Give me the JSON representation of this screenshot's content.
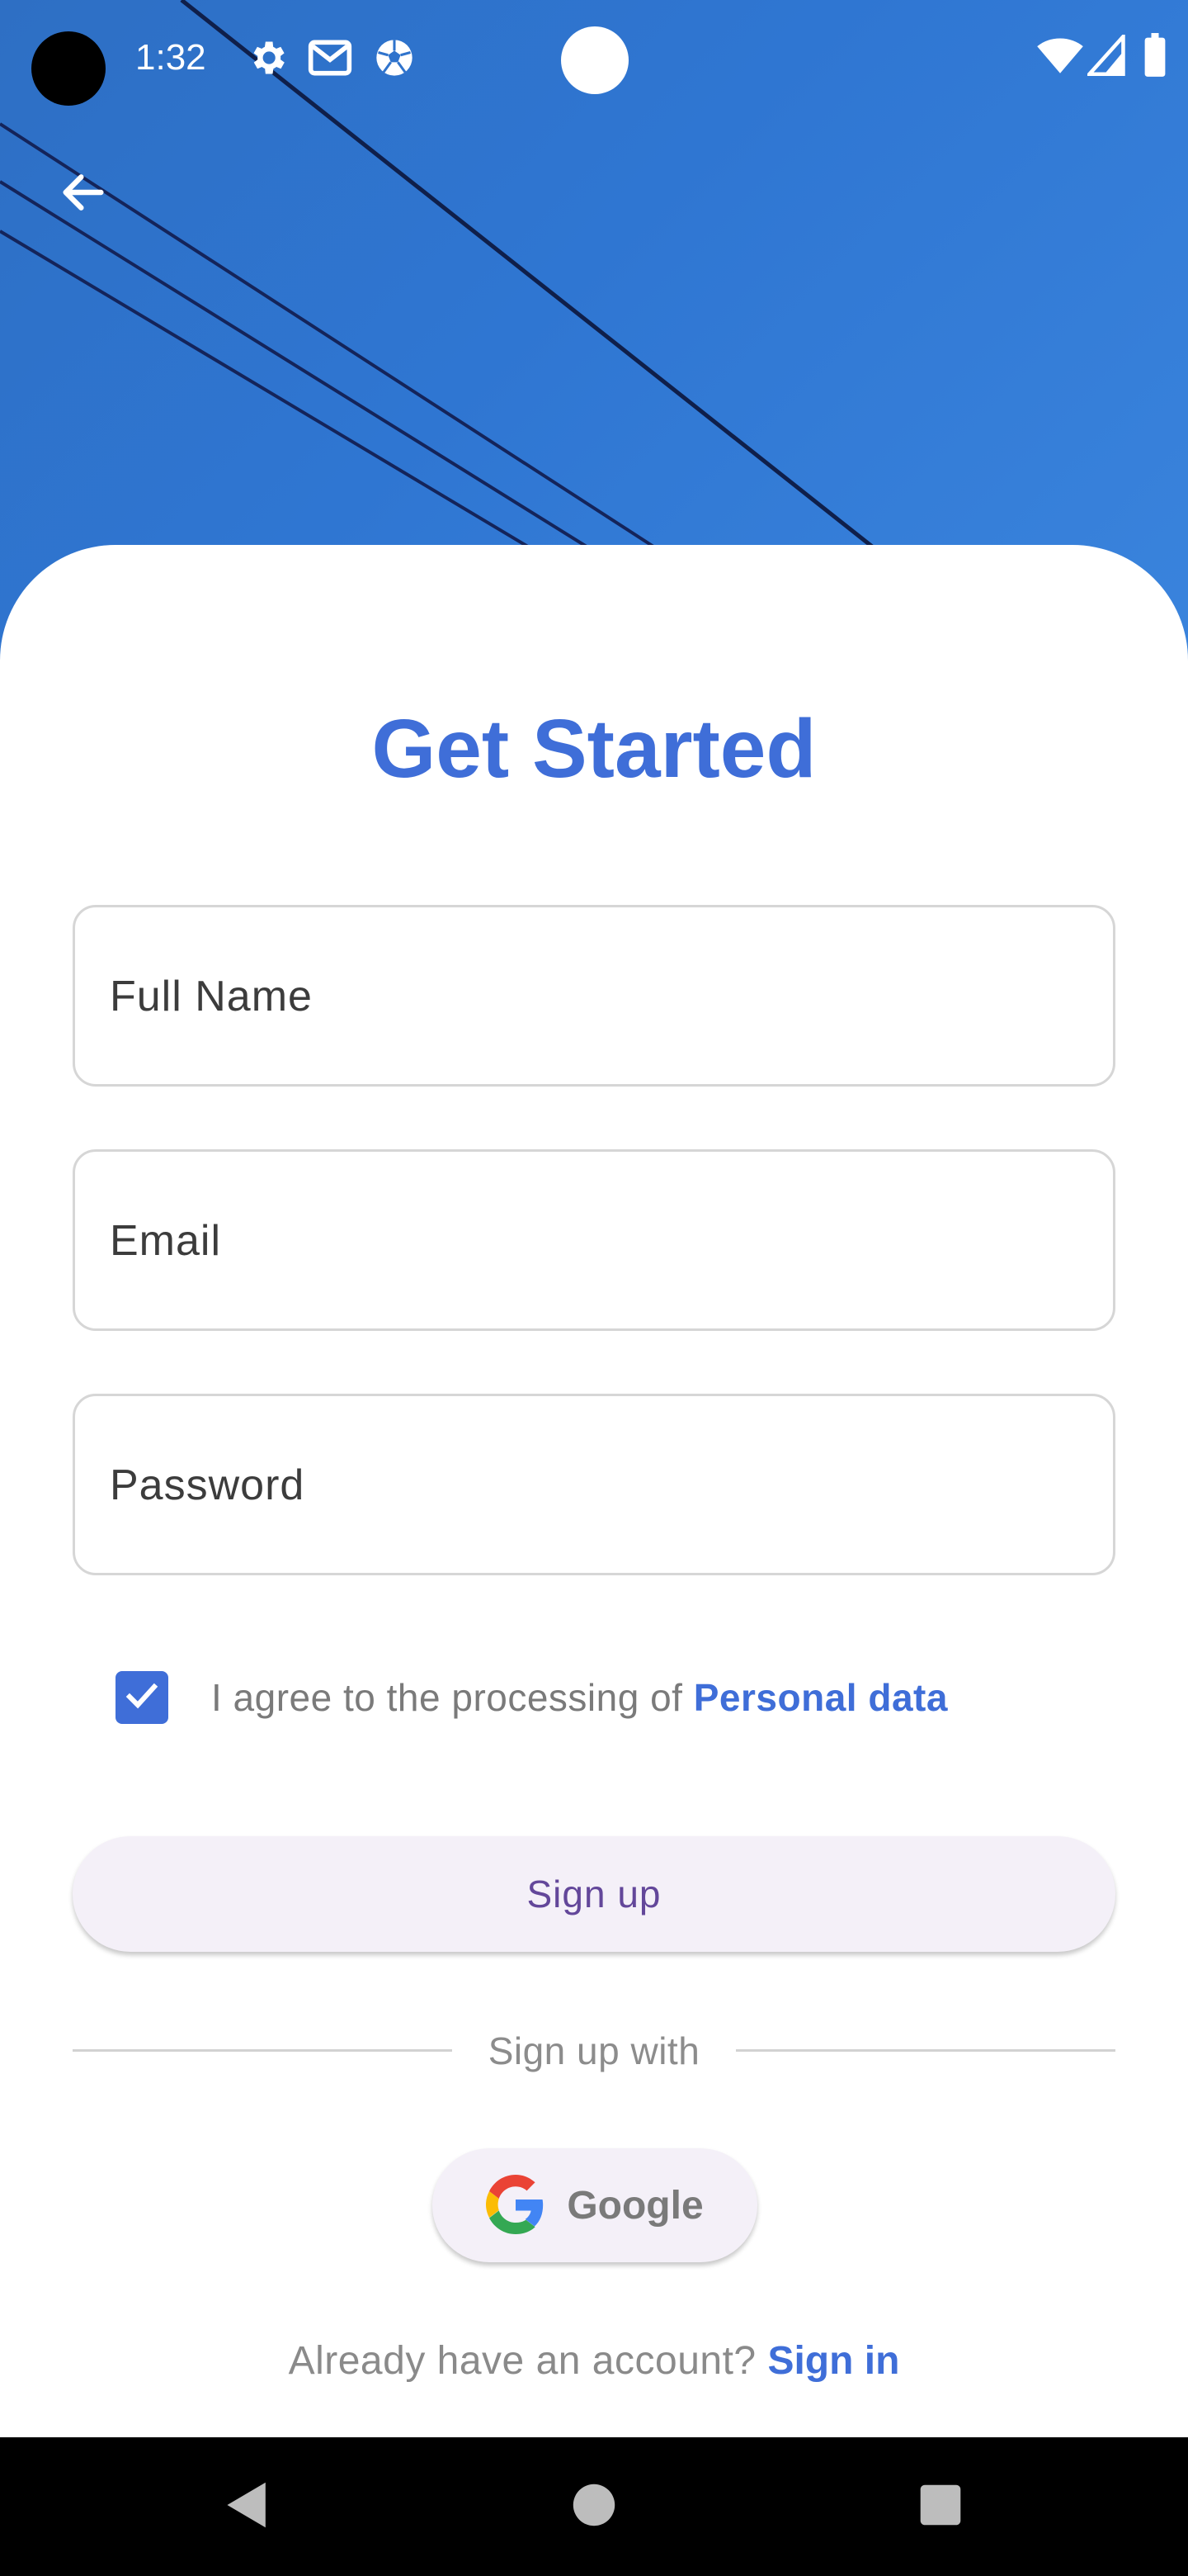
{
  "status_bar": {
    "time": "1:32",
    "icons": [
      "settings-icon",
      "gmail-icon",
      "soccer-ball-icon",
      "wifi-icon",
      "signal-icon",
      "battery-icon"
    ]
  },
  "header": {
    "back_icon": "arrow-back-icon"
  },
  "title": "Get Started",
  "fields": {
    "full_name_placeholder": "Full Name",
    "email_placeholder": "Email",
    "password_placeholder": "Password"
  },
  "agreement": {
    "checked": true,
    "text": "I agree to the processing of ",
    "link": "Personal data"
  },
  "signup_button": "Sign up",
  "divider_text": "Sign up with",
  "google_button": "Google",
  "signin": {
    "prompt": "Already have an account? ",
    "link": "Sign in"
  },
  "nav_bar": {
    "icons": [
      "back-triangle-icon",
      "home-circle-icon",
      "recents-square-icon"
    ]
  },
  "colors": {
    "accent": "#3f6ed8",
    "header_sky": "#2f76d2",
    "button_bg": "#f4f0f8",
    "button_text": "#63479a"
  }
}
